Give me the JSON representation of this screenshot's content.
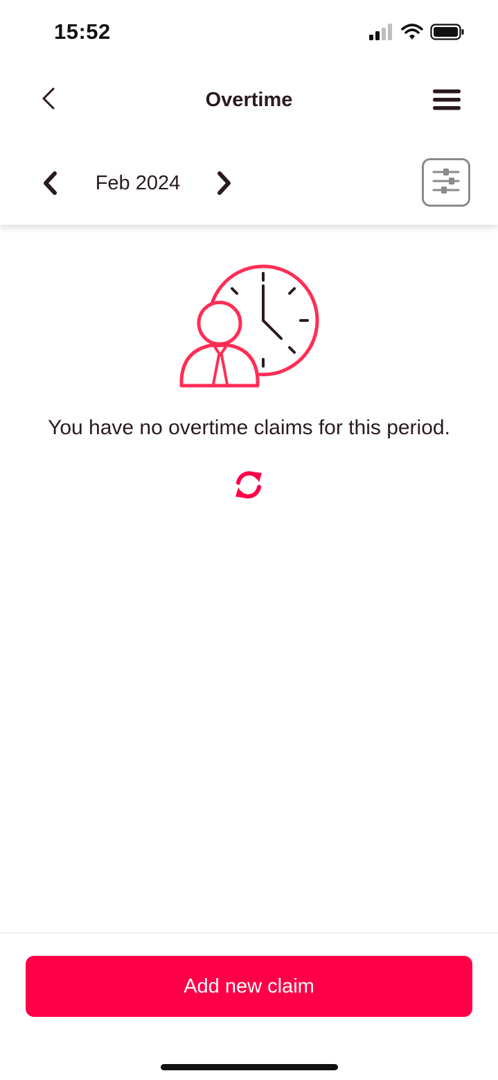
{
  "status_bar": {
    "time": "15:52",
    "icons": [
      "cellular-signal-icon",
      "wifi-icon",
      "battery-icon"
    ]
  },
  "header": {
    "title": "Overtime",
    "back_icon": "chevron-left-icon",
    "menu_icon": "hamburger-menu-icon"
  },
  "period": {
    "label": "Feb 2024",
    "prev_icon": "chevron-left-bold-icon",
    "next_icon": "chevron-right-bold-icon",
    "filter_icon": "sliders-icon"
  },
  "empty_state": {
    "illustration": "person-with-clock-icon",
    "message": "You have no overtime claims for this period.",
    "refresh_icon": "refresh-icon"
  },
  "footer": {
    "add_claim_label": "Add new claim"
  },
  "colors": {
    "accent": "#ff0048",
    "text": "#2a1a1f",
    "illustration": "#ff2d55",
    "filter_border": "#8a8a8a"
  }
}
